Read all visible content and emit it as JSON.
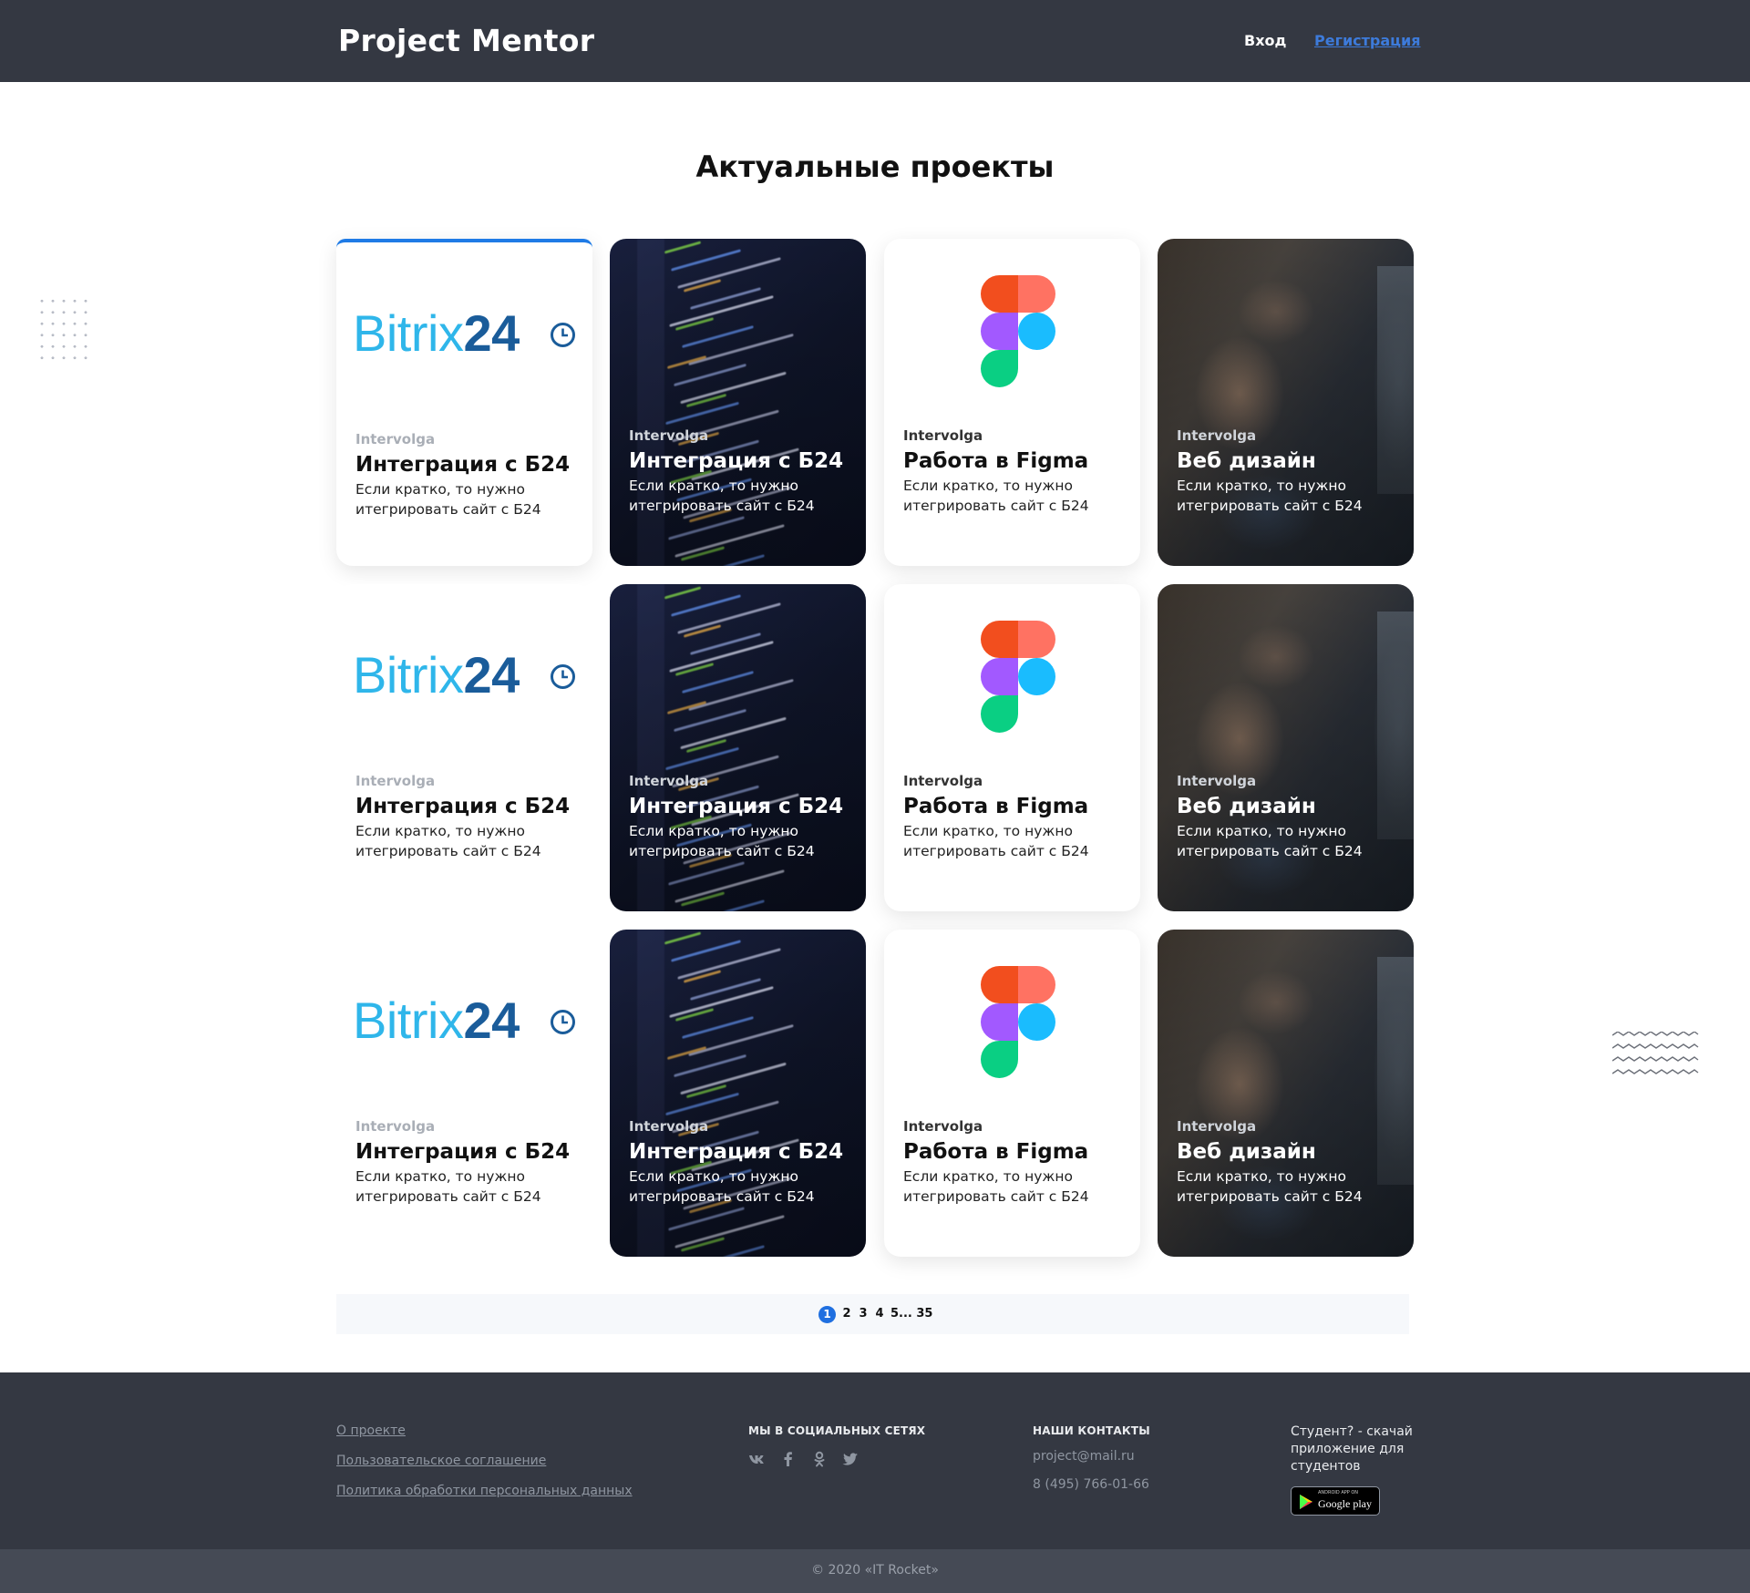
{
  "header": {
    "logo": "Project Mentor",
    "login": "Вход",
    "register": "Регистрация"
  },
  "main": {
    "title": "Актуальные проекты"
  },
  "cards": [
    {
      "type": "bitrix",
      "company": "Intervolga",
      "title": "Интеграция с Б24",
      "desc": "Если кратко, то нужно итегрировать сайт с Б24"
    },
    {
      "type": "code",
      "company": "Intervolga",
      "title": "Интеграция с Б24",
      "desc": "Если кратко, то нужно итегрировать сайт с Б24"
    },
    {
      "type": "figma",
      "company": "Intervolga",
      "title": "Работа в Figma",
      "desc": "Если кратко, то нужно итегрировать сайт с Б24"
    },
    {
      "type": "photo",
      "company": "Intervolga",
      "title": "Веб дизайн",
      "desc": "Если кратко, то нужно итегрировать сайт с Б24"
    }
  ],
  "logo_text": {
    "bitrix_light": "Bitrix",
    "bitrix_dark": "24"
  },
  "pagination": {
    "pages": [
      "1",
      "2",
      "3",
      "4",
      "5... 35"
    ],
    "active": "1"
  },
  "footer": {
    "links": [
      "О проекте",
      "Пользовательское соглашение",
      "Политика обработки персональных данных"
    ],
    "social_heading": "МЫ В СОЦИАЛЬНЫХ СЕТЯХ",
    "social_icons": [
      "vk-icon",
      "facebook-icon",
      "odnoklassniki-icon",
      "twitter-icon"
    ],
    "contacts_heading": "НАШИ КОНТАКТЫ",
    "email": "project@mail.ru",
    "phone": "8 (495) 766-01-66",
    "student_text": "Студент? - скачай приложение для студентов",
    "google_play_small": "ANDROID APP ON",
    "google_play": "Google play",
    "copyright": "© 2020 «IT Rocket»"
  },
  "colors": {
    "header_bg": "#343842",
    "accent": "#1f7be6",
    "register_link": "#3d7bdb",
    "bitrix_light": "#2fb6ea",
    "bitrix_dark": "#1a5c9a"
  }
}
